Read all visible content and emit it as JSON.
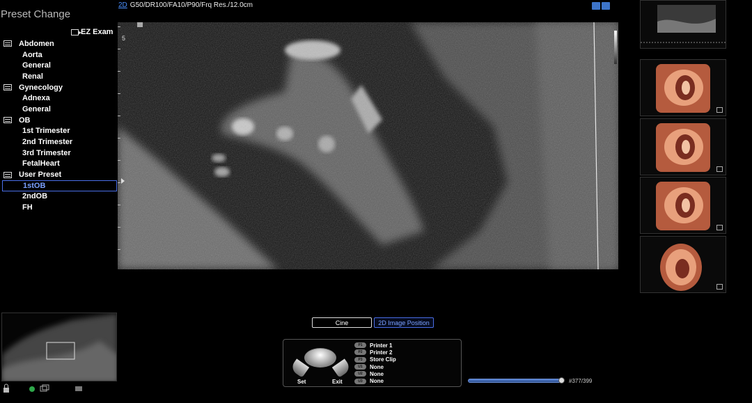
{
  "preset_panel": {
    "title": "Preset Change",
    "ez_exam_label": "EZ Exam",
    "groups": [
      {
        "label": "Abdomen",
        "items": [
          "Aorta",
          "General",
          "Renal"
        ]
      },
      {
        "label": "Gynecology",
        "items": [
          "Adnexa",
          "General"
        ]
      },
      {
        "label": "OB",
        "items": [
          "1st Trimester",
          "2nd Trimester",
          "3rd Trimester",
          "FetalHeart"
        ]
      },
      {
        "label": "User Preset",
        "items": [
          "1stOB",
          "2ndOB",
          "FH"
        ]
      }
    ],
    "selected_item": "1stOB"
  },
  "top_bar": {
    "mode": "2D",
    "params": "G50/DR100/FA10/P90/Frq Res./12.0cm"
  },
  "scale": {
    "depth_label": "5"
  },
  "tabs": {
    "cine": "Cine",
    "image_position": "2D Image Position"
  },
  "trackball": {
    "set_label": "Set",
    "exit_label": "Exit",
    "keys": [
      {
        "key": "P1",
        "label": "Printer 1"
      },
      {
        "key": "P2",
        "label": "Printer 2"
      },
      {
        "key": "P3",
        "label": "Store Clip"
      },
      {
        "key": "U1",
        "label": "None"
      },
      {
        "key": "U2",
        "label": "None"
      },
      {
        "key": "U3",
        "label": "None"
      }
    ]
  },
  "cine": {
    "frame_counter": "#377/399",
    "position_fraction": 0.945
  },
  "icons": {
    "thumbnails": [
      "ultrasound-loop-thumbnail",
      "3d-render-thumbnail",
      "3d-render-thumbnail",
      "3d-render-thumbnail",
      "3d-render-thumbnail"
    ],
    "status": [
      "lock-icon",
      "power-icon",
      "monitor-icon",
      "printer-icon"
    ]
  },
  "colors": {
    "accent": "#4a6ee8",
    "selected_text": "#7aa0ff",
    "render_flesh": "#c97050"
  }
}
